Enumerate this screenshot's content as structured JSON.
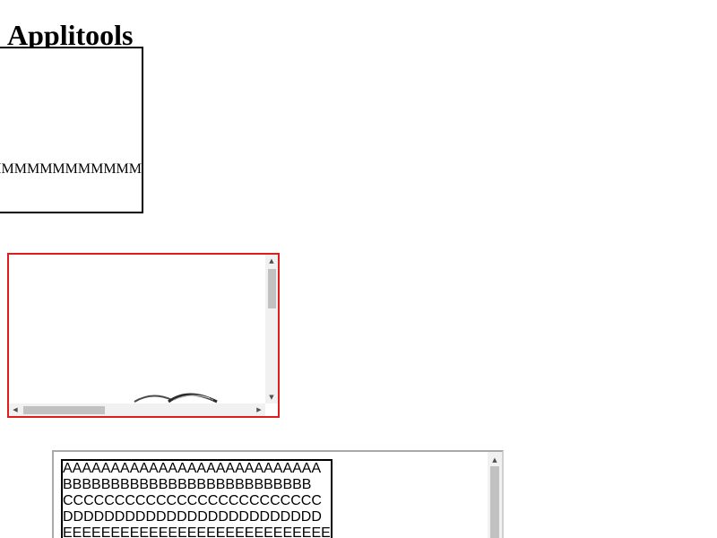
{
  "page": {
    "title": "Applitools"
  },
  "box1": {
    "text": "MMMMMMMMMMMMMMMMMMMMMMMMMMMMMMMMMMMMMMMMMMMMMMMMMM"
  },
  "frame2": {
    "image_icon": "partial-image",
    "scroll_up_icon": "scroll-up-arrow",
    "scroll_down_icon": "scroll-down-arrow",
    "scroll_left_icon": "scroll-left-arrow",
    "scroll_right_icon": "scroll-right-arrow",
    "border_color": "#e01c1c"
  },
  "frame3": {
    "lines": [
      "AAAAAAAAAAAAAAAAAAAAAAAAAAA",
      "BBBBBBBBBBBBBBBBBBBBBBBBBB",
      "CCCCCCCCCCCCCCCCCCCCCCCCC",
      "DDDDDDDDDDDDDDDDDDDDDDDDD",
      "EEEEEEEEEEEEEEEEEEEEEEEEEEEE"
    ]
  }
}
